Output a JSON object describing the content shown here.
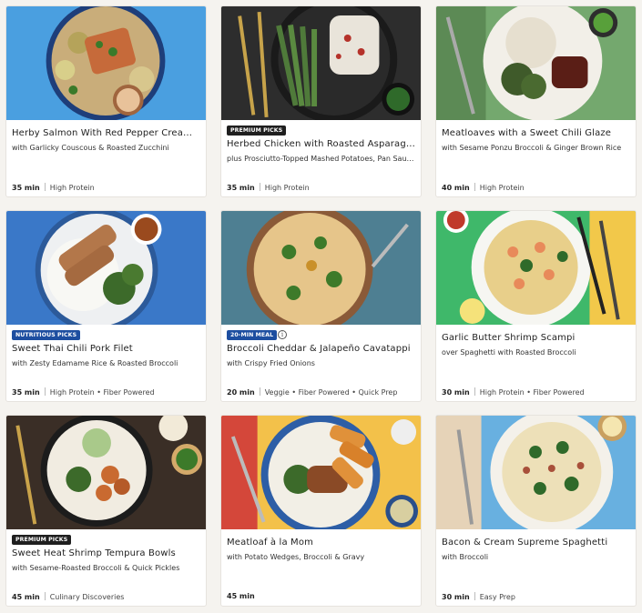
{
  "recipes": [
    {
      "title": "Herby Salmon With Red Pepper Cream Sauce",
      "subtitle": "with Garlicky Couscous & Roasted Zucchini",
      "time": "35 min",
      "tags": "High Protein",
      "badge": ""
    },
    {
      "title": "Herbed Chicken with Roasted Asparagus",
      "subtitle": "plus Prosciutto-Topped Mashed Potatoes, Pan Sauce & Parmesan",
      "time": "35 min",
      "tags": "High Protein",
      "badge": "Premium Picks"
    },
    {
      "title": "Meatloaves with a Sweet Chili Glaze",
      "subtitle": "with Sesame Ponzu Broccoli & Ginger Brown Rice",
      "time": "40 min",
      "tags": "High Protein",
      "badge": ""
    },
    {
      "title": "Sweet Thai Chili Pork Filet",
      "subtitle": "with Zesty Edamame Rice & Roasted Broccoli",
      "time": "35 min",
      "tags": "High Protein • Fiber Powered",
      "badge": "Nutritious Picks"
    },
    {
      "title": "Broccoli Cheddar & Jalapeño Cavatappi",
      "subtitle": "with Crispy Fried Onions",
      "time": "20 min",
      "tags": "Veggie • Fiber Powered • Quick Prep",
      "badge": "20-Min Meal"
    },
    {
      "title": "Garlic Butter Shrimp Scampi",
      "subtitle": "over Spaghetti with Roasted Broccoli",
      "time": "30 min",
      "tags": "High Protein • Fiber Powered",
      "badge": ""
    },
    {
      "title": "Sweet Heat Shrimp Tempura Bowls",
      "subtitle": "with Sesame-Roasted Broccoli & Quick Pickles",
      "time": "45 min",
      "tags": "Culinary Discoveries",
      "badge": "Premium Picks"
    },
    {
      "title": "Meatloaf à la Mom",
      "subtitle": "with Potato Wedges, Broccoli & Gravy",
      "time": "45 min",
      "tags": "",
      "badge": ""
    },
    {
      "title": "Bacon & Cream Supreme Spaghetti",
      "subtitle": "with Broccoli",
      "time": "30 min",
      "tags": "Easy Prep",
      "badge": ""
    }
  ],
  "colors": {
    "premium_badge": "#1f1f1f",
    "nutritious_badge": "#1d4ea0",
    "quick_badge": "#1d4ea0",
    "card_bg": "#ffffff",
    "page_bg": "#f5f3ef"
  }
}
